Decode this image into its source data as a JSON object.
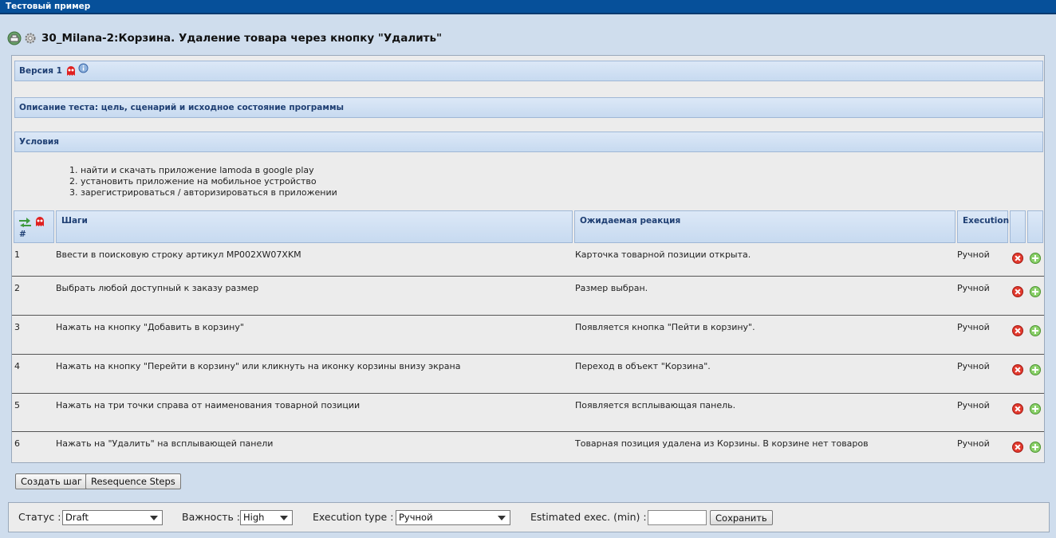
{
  "window": {
    "title": "Тестовый пример"
  },
  "testcase": {
    "title": "30_Milana-2:Корзина. Удаление товара через кнопку \"Удалить\""
  },
  "sections": {
    "version": "Версия 1",
    "description": "Описание теста: цель, сценарий и исходное состояние программы",
    "preconditions": "Условия"
  },
  "preconditions": [
    "найти и скачать приложение lamoda  в google play",
    "установить приложение на мобильное устройство",
    "зарегистрироваться / авторизироваться в приложении"
  ],
  "steps_table": {
    "col_num": "#",
    "col_steps": "Шаги",
    "col_expected": "Ожидаемая реакция",
    "col_execution": "Execution",
    "rows": [
      {
        "num": "1",
        "step": "Ввести в поисковую строку артикул MP002XW07XKM",
        "expected": "Карточка товарной позиции открыта.",
        "execution": "Ручной"
      },
      {
        "num": "2",
        "step": "Выбрать любой доступный к заказу размер",
        "expected": "Размер выбран.",
        "execution": "Ручной"
      },
      {
        "num": "3",
        "step": "Нажать на кнопку \"Добавить в корзину\"",
        "expected": "Появляется кнопка \"Пейти в корзину\".",
        "execution": "Ручной"
      },
      {
        "num": "4",
        "step": "Нажать на кнопку \"Перейти в корзину\" или кликнуть на иконку корзины внизу экрана",
        "expected": "Переход в объект \"Корзина\".",
        "execution": "Ручной"
      },
      {
        "num": "5",
        "step": "Нажать на три точки справа от наименования товарной позиции",
        "expected": "Появляется всплывающая панель.",
        "execution": "Ручной"
      },
      {
        "num": "6",
        "step": "Нажать на \"Удалить\" на всплывающей панели",
        "expected": "Товарная позиция удалена из Корзины. В корзине нет товаров",
        "execution": "Ручной"
      }
    ]
  },
  "buttons": {
    "create_step": "Создать шаг",
    "resequence": "Resequence Steps",
    "save": "Сохранить"
  },
  "footer": {
    "status_label": "Статус :",
    "status_value": "Draft",
    "importance_label": "Важность :",
    "importance_value": "High",
    "exec_type_label": "Execution type :",
    "exec_type_value": "Ручной",
    "estimated_label": "Estimated exec. (min) :",
    "estimated_value": ""
  },
  "icons": {
    "heading": [
      "print-icon",
      "gear-icon"
    ],
    "version": [
      "ghost-icon",
      "info-icon"
    ],
    "table_header": [
      "reorder-arrows-icon",
      "ghost-icon"
    ],
    "row_actions": [
      "delete-icon",
      "add-icon"
    ]
  },
  "colors": {
    "titlebar": "#06509a",
    "section_text": "#1f3f73",
    "page_bg": "#cfdded",
    "delete": "#e23a2e",
    "add": "#8bd06a"
  }
}
